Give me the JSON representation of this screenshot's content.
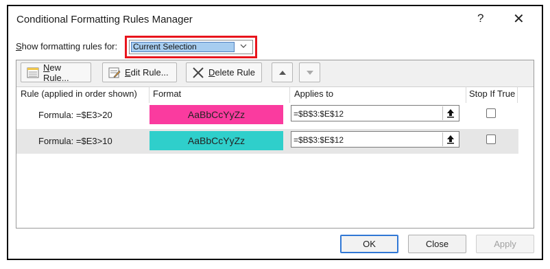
{
  "window": {
    "title": "Conditional Formatting Rules Manager",
    "help": "?",
    "close": "✕"
  },
  "show_rules": {
    "label_prefix": "S",
    "label_rest": "how formatting rules for:",
    "selected": "Current Selection"
  },
  "toolbar": {
    "new_rule_u": "N",
    "new_rule_rest": "ew Rule...",
    "edit_rule_u": "E",
    "edit_rule_rest": "dit Rule...",
    "delete_rule_u": "D",
    "delete_rule_rest": "elete Rule"
  },
  "columns": {
    "rule": "Rule (applied in order shown)",
    "format": "Format",
    "applies": "Applies to",
    "stop": "Stop If True"
  },
  "rules": [
    {
      "formula": "Formula: =$E3>20",
      "preview": "AaBbCcYyZz",
      "color": "#fa3b9f",
      "applies": "=$B$3:$E$12",
      "stop_if_true": false
    },
    {
      "formula": "Formula: =$E3>10",
      "preview": "AaBbCcYyZz",
      "color": "#2fcfcb",
      "applies": "=$B$3:$E$12",
      "stop_if_true": false
    }
  ],
  "buttons": {
    "ok": "OK",
    "close": "Close",
    "apply": "Apply"
  }
}
